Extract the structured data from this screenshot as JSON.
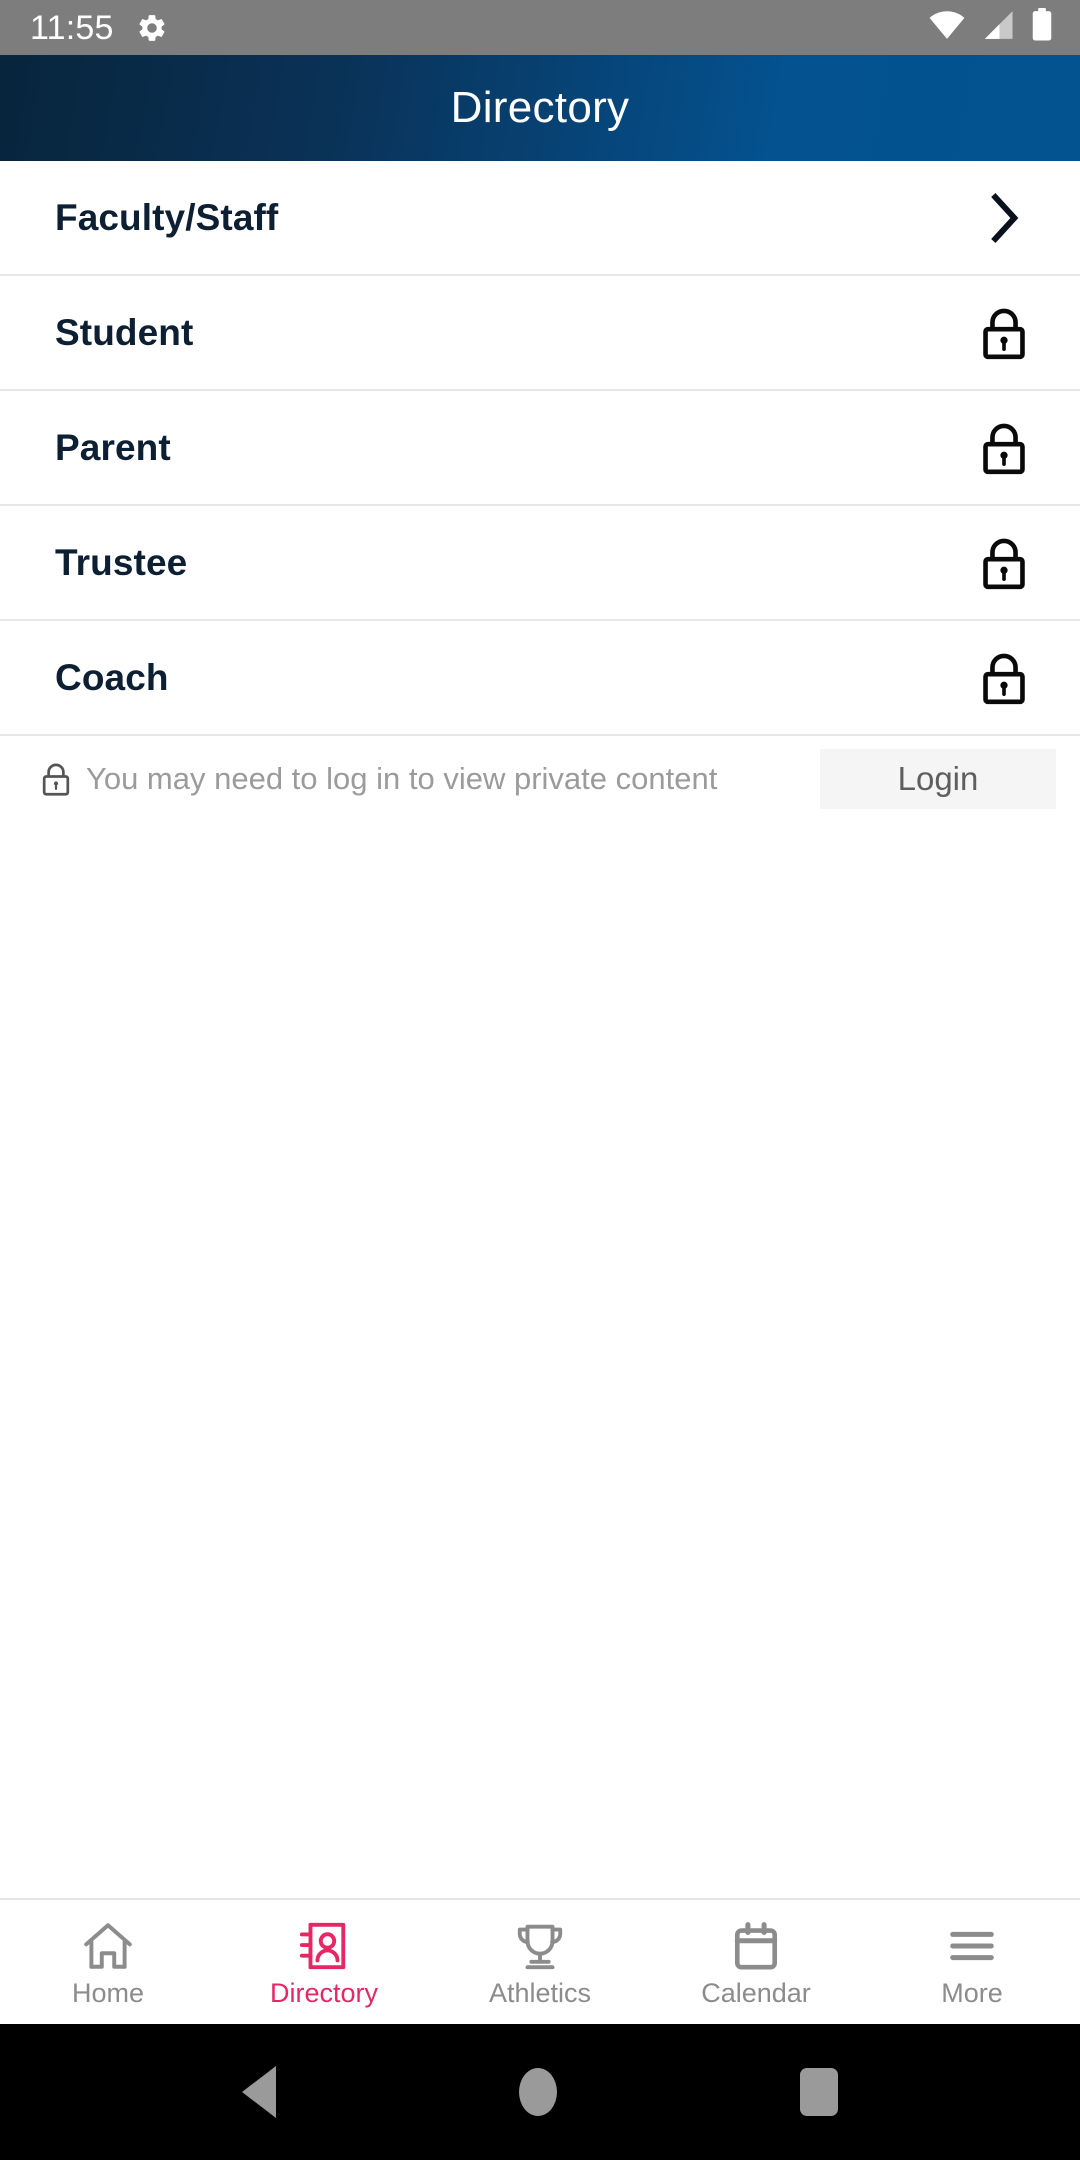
{
  "status_bar": {
    "time": "11:55",
    "icons": [
      "gear-icon",
      "wifi-icon",
      "cellular-signal-icon",
      "battery-icon"
    ]
  },
  "header": {
    "title": "Directory",
    "gradient_from": "#07253c",
    "gradient_to": "#02538f"
  },
  "directory": {
    "rows": [
      {
        "label": "Faculty/Staff",
        "icon": "chevron-right-icon",
        "locked": false
      },
      {
        "label": "Student",
        "icon": "lock-icon",
        "locked": true
      },
      {
        "label": "Parent",
        "icon": "lock-icon",
        "locked": true
      },
      {
        "label": "Trustee",
        "icon": "lock-icon",
        "locked": true
      },
      {
        "label": "Coach",
        "icon": "lock-icon",
        "locked": true
      }
    ]
  },
  "login_banner": {
    "icon": "lock-icon",
    "message": "You may need to log in to view private content",
    "button_label": "Login"
  },
  "tab_bar": {
    "active_color": "#e52765",
    "inactive_color": "#8c8c8c",
    "tabs": [
      {
        "label": "Home",
        "icon": "home-icon",
        "active": false
      },
      {
        "label": "Directory",
        "icon": "contact-book-icon",
        "active": true
      },
      {
        "label": "Athletics",
        "icon": "trophy-icon",
        "active": false
      },
      {
        "label": "Calendar",
        "icon": "calendar-icon",
        "active": false
      },
      {
        "label": "More",
        "icon": "hamburger-icon",
        "active": false
      }
    ]
  },
  "system_nav": {
    "buttons": [
      "back-triangle-icon",
      "home-circle-icon",
      "recents-square-icon"
    ]
  }
}
